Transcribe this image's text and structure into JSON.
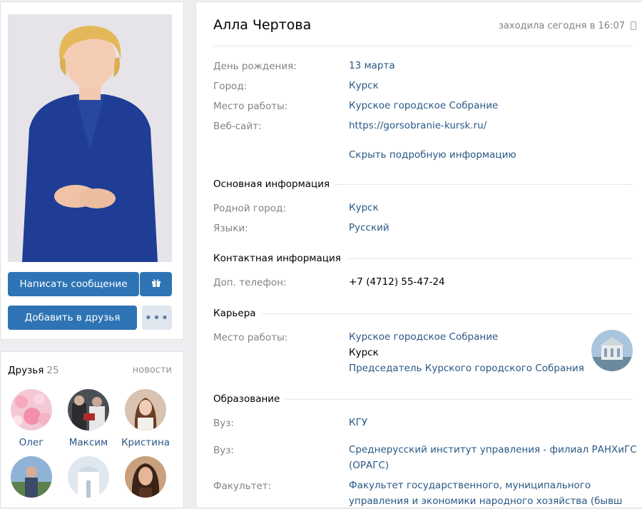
{
  "profile": {
    "name": "Алла Чертова",
    "online_status": "заходила сегодня в 16:07"
  },
  "actions": {
    "message_label": "Написать сообщение",
    "add_friend_label": "Добавить в друзья",
    "more_label": "•••"
  },
  "friends": {
    "title": "Друзья",
    "count": "25",
    "news_label": "новости",
    "list": [
      {
        "name": "Олег"
      },
      {
        "name": "Максим"
      },
      {
        "name": "Кристина"
      }
    ]
  },
  "summary": [
    {
      "label": "День рождения:",
      "value": "13 марта"
    },
    {
      "label": "Город:",
      "value": "Курск"
    },
    {
      "label": "Место работы:",
      "value": "Курское городское Собрание"
    },
    {
      "label": "Веб-сайт:",
      "value": "https://gorsobranie-kursk.ru/"
    }
  ],
  "hide_details_label": "Скрыть подробную информацию",
  "sections": {
    "main_info": {
      "title": "Основная информация",
      "rows": [
        {
          "label": "Родной город:",
          "value": "Курск"
        },
        {
          "label": "Языки:",
          "value": "Русский"
        }
      ]
    },
    "contacts": {
      "title": "Контактная информация",
      "rows": [
        {
          "label": "Доп. телефон:",
          "value": "+7 (4712) 55-47-24"
        }
      ]
    },
    "career": {
      "title": "Карьера",
      "label": "Место работы:",
      "org": "Курское городское Собрание",
      "city": "Курск",
      "position": "Председатель Курского городского Собрания"
    },
    "education": {
      "title": "Образование",
      "rows": [
        {
          "label": "Вуз:",
          "value": "КГУ"
        },
        {
          "label": "Вуз:",
          "value_line1": "Среднерусский институт управления - филиал РАНХиГС",
          "value_line2": "(ОРАГС)"
        },
        {
          "label": "Факультет:",
          "value_line1": "Факультет государственного, муниципального",
          "value_line2": "управления и экономики народного хозяйства (бывш"
        }
      ]
    }
  },
  "colors": {
    "link": "#2a5885",
    "button": "#2e74b5",
    "muted": "#828282",
    "background": "#edeef0"
  }
}
